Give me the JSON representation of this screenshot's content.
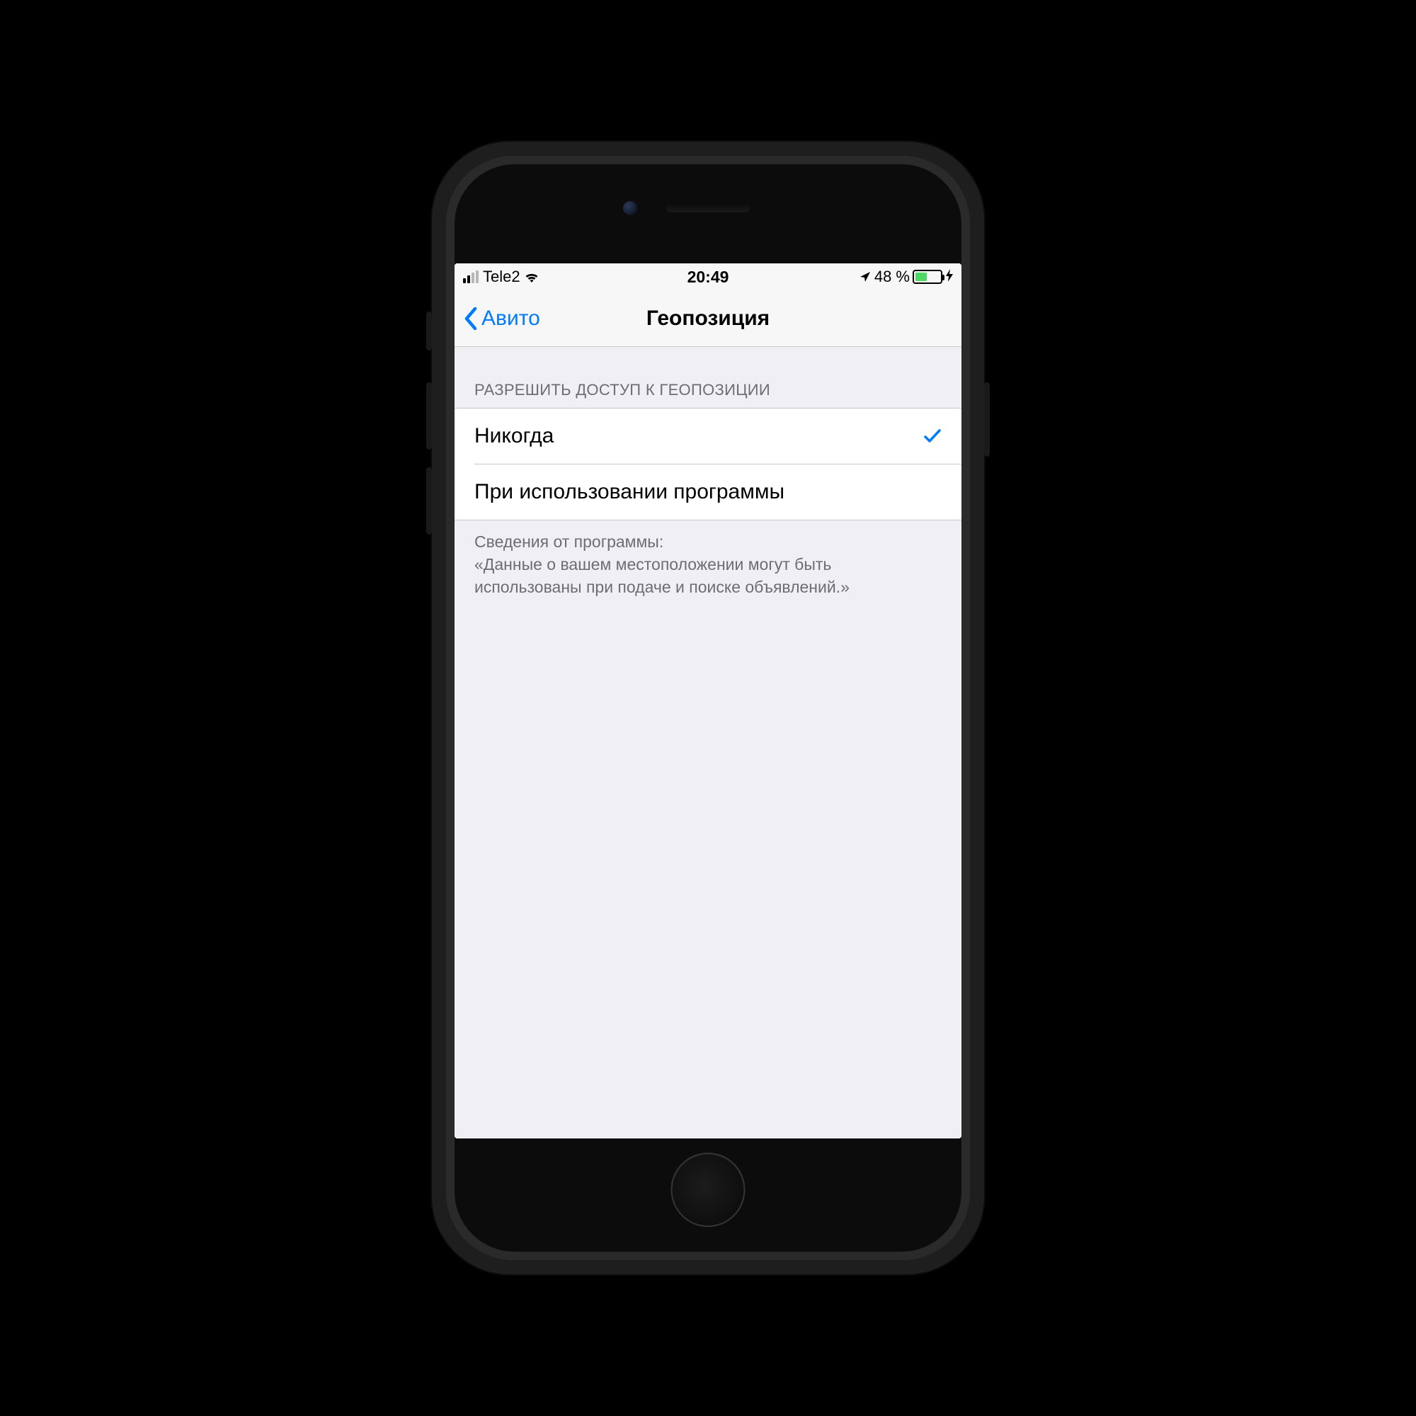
{
  "status_bar": {
    "carrier": "Tele2",
    "time": "20:49",
    "battery_percent": "48 %"
  },
  "nav": {
    "back_label": "Авито",
    "title": "Геопозиция"
  },
  "section": {
    "header": "РАЗРЕШИТЬ ДОСТУП К ГЕОПОЗИЦИИ",
    "options": [
      {
        "label": "Никогда",
        "selected": true
      },
      {
        "label": "При использовании программы",
        "selected": false
      }
    ],
    "footer_title": "Сведения от программы:",
    "footer_body": "«Данные о вашем местоположении могут быть использованы при подаче и поиске объявлений.»"
  }
}
